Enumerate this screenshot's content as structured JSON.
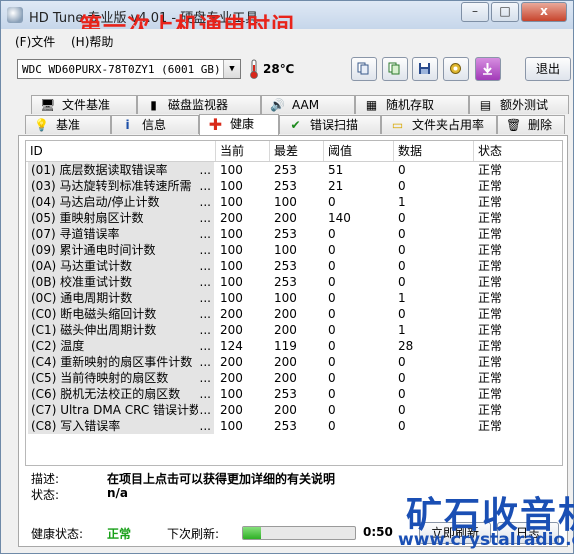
{
  "window": {
    "title": "HD Tune 专业版 v4.01 - 硬盘专业工具",
    "overlay_title": "第一次上机通电时间",
    "controls": {
      "minimize": "–",
      "maximize": "□",
      "close": "x"
    }
  },
  "menu": {
    "items": [
      "(F)文件",
      "(H)帮助"
    ]
  },
  "toolbar": {
    "drive": "WDC WD60PURX-78T0ZY1 (6001 GB)",
    "temperature": "28℃",
    "buttons": [
      "copy-info-icon",
      "copy-screenshot-icon",
      "save-icon",
      "options-icon",
      "download-icon"
    ],
    "exit_label": "退出"
  },
  "tabs": {
    "row1": [
      "文件基准",
      "磁盘监视器",
      "AAM",
      "随机存取",
      "额外测试"
    ],
    "row2": [
      "基准",
      "信息",
      "健康",
      "错误扫描",
      "文件夹占用率",
      "删除"
    ],
    "active": "健康"
  },
  "table": {
    "headers": [
      "ID",
      "当前",
      "最差",
      "阈值",
      "数据",
      "状态"
    ],
    "rows": [
      {
        "id": "(01) 底层数据读取错误率",
        "current": "100",
        "worst": "253",
        "threshold": "51",
        "data": "0",
        "status": "正常"
      },
      {
        "id": "(03) 马达旋转到标准转速所需",
        "current": "100",
        "worst": "253",
        "threshold": "21",
        "data": "0",
        "status": "正常"
      },
      {
        "id": "(04) 马达启动/停止计数",
        "current": "100",
        "worst": "100",
        "threshold": "0",
        "data": "1",
        "status": "正常"
      },
      {
        "id": "(05) 重映射扇区计数",
        "current": "200",
        "worst": "200",
        "threshold": "140",
        "data": "0",
        "status": "正常"
      },
      {
        "id": "(07) 寻道错误率",
        "current": "100",
        "worst": "253",
        "threshold": "0",
        "data": "0",
        "status": "正常"
      },
      {
        "id": "(09) 累计通电时间计数",
        "current": "100",
        "worst": "100",
        "threshold": "0",
        "data": "0",
        "status": "正常"
      },
      {
        "id": "(0A) 马达重试计数",
        "current": "100",
        "worst": "253",
        "threshold": "0",
        "data": "0",
        "status": "正常"
      },
      {
        "id": "(0B) 校准重试计数",
        "current": "100",
        "worst": "253",
        "threshold": "0",
        "data": "0",
        "status": "正常"
      },
      {
        "id": "(0C) 通电周期计数",
        "current": "100",
        "worst": "100",
        "threshold": "0",
        "data": "1",
        "status": "正常"
      },
      {
        "id": "(C0) 断电磁头缩回计数",
        "current": "200",
        "worst": "200",
        "threshold": "0",
        "data": "0",
        "status": "正常"
      },
      {
        "id": "(C1) 磁头伸出周期计数",
        "current": "200",
        "worst": "200",
        "threshold": "0",
        "data": "1",
        "status": "正常"
      },
      {
        "id": "(C2) 温度",
        "current": "124",
        "worst": "119",
        "threshold": "0",
        "data": "28",
        "status": "正常"
      },
      {
        "id": "(C4) 重新映射的扇区事件计数",
        "current": "200",
        "worst": "200",
        "threshold": "0",
        "data": "0",
        "status": "正常"
      },
      {
        "id": "(C5) 当前待映射的扇区数",
        "current": "200",
        "worst": "200",
        "threshold": "0",
        "data": "0",
        "status": "正常"
      },
      {
        "id": "(C6) 脱机无法校正的扇区数",
        "current": "100",
        "worst": "253",
        "threshold": "0",
        "data": "0",
        "status": "正常"
      },
      {
        "id": "(C7) Ultra DMA CRC 错误计数",
        "current": "200",
        "worst": "200",
        "threshold": "0",
        "data": "0",
        "status": "正常"
      },
      {
        "id": "(C8) 写入错误率",
        "current": "100",
        "worst": "253",
        "threshold": "0",
        "data": "0",
        "status": "正常"
      }
    ]
  },
  "details": {
    "desc_label": "描述:",
    "desc_value": "在项目上点击可以获得更加详细的有关说明",
    "status_label": "状态:",
    "status_value": "n/a"
  },
  "footer": {
    "health_label": "健康状态:",
    "health_value": "正常",
    "health_color": "#18a018",
    "refresh_label": "下次刷新:",
    "refresh_progress": 0.16,
    "refresh_time": "0:50",
    "refresh_button": "立即刷新",
    "log_button": "日志"
  },
  "watermark": {
    "text": "矿石收音机",
    "url": "www.crystalradio.cn"
  }
}
